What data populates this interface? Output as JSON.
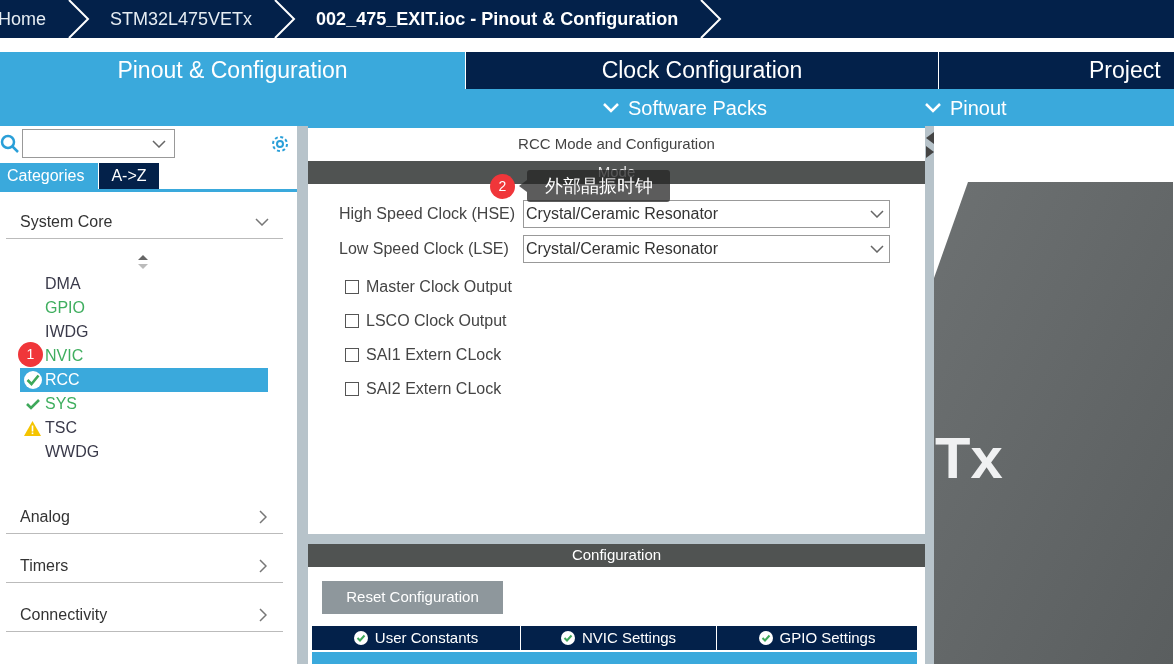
{
  "breadcrumb": [
    {
      "label": "Home",
      "current": false
    },
    {
      "label": "STM32L475VETx",
      "current": false
    },
    {
      "label": "002_475_EXIT.ioc - Pinout & Configuration",
      "current": true
    }
  ],
  "main_tabs": [
    {
      "label": "Pinout & Configuration",
      "selected": true
    },
    {
      "label": "Clock Configuration",
      "selected": false
    },
    {
      "label": "Project",
      "selected": false
    }
  ],
  "sub_menus": [
    {
      "label": "Software Packs"
    },
    {
      "label": "Pinout"
    }
  ],
  "view_tabs": [
    {
      "label": "Categories",
      "selected": true
    },
    {
      "label": "A->Z",
      "selected": false
    }
  ],
  "categories": [
    {
      "label": "System Core",
      "expanded": true,
      "children": [
        {
          "label": "DMA",
          "selected": false,
          "kind": "plain"
        },
        {
          "label": "GPIO",
          "selected": false,
          "kind": "configured"
        },
        {
          "label": "IWDG",
          "selected": false,
          "kind": "plain"
        },
        {
          "label": "NVIC",
          "selected": false,
          "kind": "configured"
        },
        {
          "label": "RCC",
          "selected": true,
          "kind": "ok"
        },
        {
          "label": "SYS",
          "selected": false,
          "kind": "ok"
        },
        {
          "label": "TSC",
          "selected": false,
          "kind": "warning"
        },
        {
          "label": "WWDG",
          "selected": false,
          "kind": "plain"
        }
      ]
    },
    {
      "label": "Analog",
      "expanded": false
    },
    {
      "label": "Timers",
      "expanded": false
    },
    {
      "label": "Connectivity",
      "expanded": false
    }
  ],
  "panel": {
    "title": "RCC Mode and Configuration",
    "mode_header": "Mode",
    "fields": [
      {
        "label": "High Speed Clock (HSE)",
        "value": "Crystal/Ceramic Resonator"
      },
      {
        "label": "Low Speed Clock (LSE)",
        "value": "Crystal/Ceramic Resonator"
      }
    ],
    "options": [
      {
        "label": "Master Clock Output",
        "checked": false
      },
      {
        "label": "LSCO Clock Output",
        "checked": false
      },
      {
        "label": "SAI1 Extern CLock",
        "checked": false
      },
      {
        "label": "SAI2 Extern CLock",
        "checked": false
      }
    ]
  },
  "configuration": {
    "header": "Configuration",
    "reset_button": "Reset Configuration",
    "tabs": [
      {
        "label": "User Constants",
        "selected": false
      },
      {
        "label": "NVIC Settings",
        "selected": false
      },
      {
        "label": "GPIO Settings",
        "selected": false
      }
    ]
  },
  "chip": {
    "label": "Tx"
  },
  "annotations": [
    {
      "number": "1"
    },
    {
      "number": "2",
      "text": "外部晶振时钟"
    }
  ]
}
